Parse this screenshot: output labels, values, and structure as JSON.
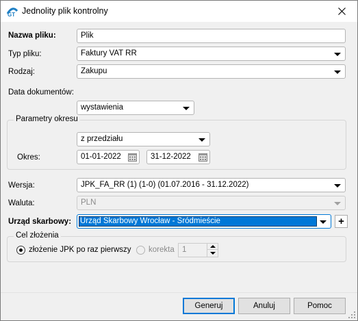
{
  "window": {
    "title": "Jednolity plik kontrolny",
    "icon": "app-logo-icon",
    "close_icon": "close-icon"
  },
  "form": {
    "nazwa_pliku": {
      "label": "Nazwa pliku:",
      "value": "Plik"
    },
    "typ_pliku": {
      "label": "Typ pliku:",
      "value": "Faktury VAT RR"
    },
    "rodzaj": {
      "label": "Rodzaj:",
      "value": "Zakupu"
    },
    "data_dokumentow": {
      "label": "Data dokumentów:",
      "value": "wystawienia"
    },
    "parametry_okresu": {
      "title": "Parametry okresu",
      "zakres": "z przedziału",
      "okres_label": "Okres:",
      "od": "01-01-2022",
      "do": "31-12-2022"
    },
    "wersja": {
      "label": "Wersja:",
      "value": "JPK_FA_RR (1) (1-0) (01.07.2016 - 31.12.2022)"
    },
    "waluta": {
      "label": "Waluta:",
      "value": "PLN"
    },
    "urzad": {
      "label": "Urząd skarbowy:",
      "value": "Urząd Skarbowy Wrocław - Śródmieście",
      "add_label": "+"
    },
    "cel_zlozenia": {
      "title": "Cel złożenia",
      "option1": "złożenie JPK po raz pierwszy",
      "option2": "korekta",
      "korekta_value": "1",
      "selected": "option1"
    }
  },
  "buttons": {
    "generuj": "Generuj",
    "anuluj": "Anuluj",
    "pomoc": "Pomoc"
  },
  "colors": {
    "accent": "#0078d7",
    "background": "#f0f0f0",
    "disabled_text": "#8a8a8a"
  }
}
